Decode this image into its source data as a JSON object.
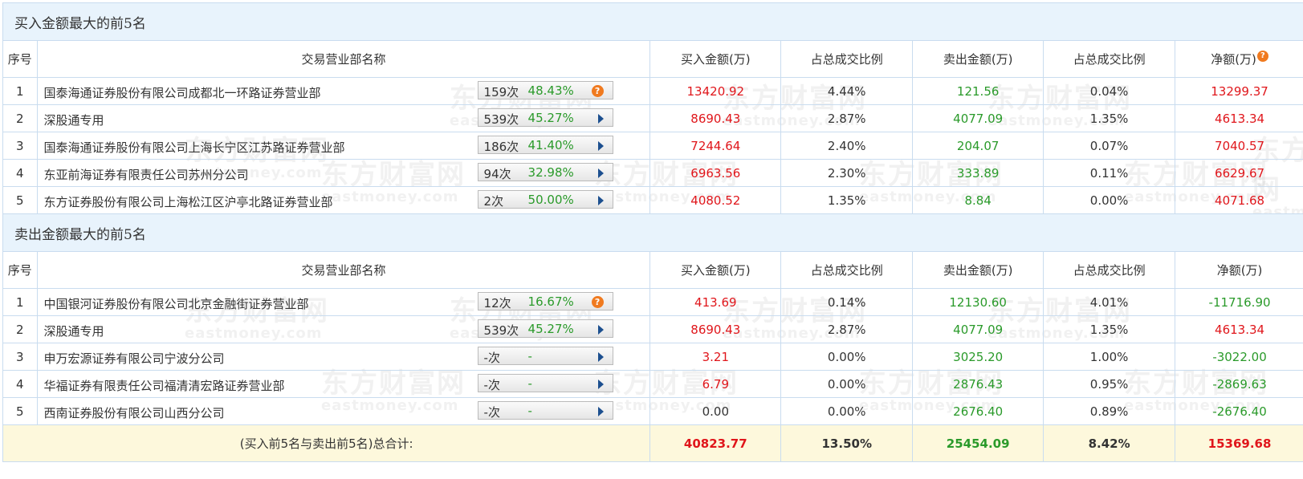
{
  "watermark": {
    "cn": "东方财富网",
    "en": "eastmoney.com"
  },
  "buy_section": {
    "title": "买入金额最大的前5名",
    "headers": [
      "序号",
      "交易营业部名称",
      "买入金额(万)",
      "占总成交比例",
      "卖出金额(万)",
      "占总成交比例",
      "净额(万)"
    ],
    "rows": [
      {
        "idx": "1",
        "name": "国泰海通证券股份有限公司成都北一环路证券营业部",
        "count": "159次",
        "pct": "48.43%",
        "icon": "question-icon",
        "buy": "13420.92",
        "buy_ratio": "4.44%",
        "sell": "121.56",
        "sell_ratio": "0.04%",
        "net": "13299.37"
      },
      {
        "idx": "2",
        "name": "深股通专用",
        "count": "539次",
        "pct": "45.27%",
        "icon": "arrow-right-icon",
        "buy": "8690.43",
        "buy_ratio": "2.87%",
        "sell": "4077.09",
        "sell_ratio": "1.35%",
        "net": "4613.34"
      },
      {
        "idx": "3",
        "name": "国泰海通证券股份有限公司上海长宁区江苏路证券营业部",
        "count": "186次",
        "pct": "41.40%",
        "icon": "arrow-right-icon",
        "buy": "7244.64",
        "buy_ratio": "2.40%",
        "sell": "204.07",
        "sell_ratio": "0.07%",
        "net": "7040.57"
      },
      {
        "idx": "4",
        "name": "东亚前海证券有限责任公司苏州分公司",
        "count": "94次",
        "pct": "32.98%",
        "icon": "arrow-right-icon",
        "buy": "6963.56",
        "buy_ratio": "2.30%",
        "sell": "333.89",
        "sell_ratio": "0.11%",
        "net": "6629.67"
      },
      {
        "idx": "5",
        "name": "东方证券股份有限公司上海松江区沪亭北路证券营业部",
        "count": "2次",
        "pct": "50.00%",
        "icon": "arrow-right-icon",
        "buy": "4080.52",
        "buy_ratio": "1.35%",
        "sell": "8.84",
        "sell_ratio": "0.00%",
        "net": "4071.68"
      }
    ]
  },
  "sell_section": {
    "title": "卖出金额最大的前5名",
    "headers": [
      "序号",
      "交易营业部名称",
      "买入金额(万)",
      "占总成交比例",
      "卖出金额(万)",
      "占总成交比例",
      "净额(万)"
    ],
    "rows": [
      {
        "idx": "1",
        "name": "中国银河证券股份有限公司北京金融街证券营业部",
        "count": "12次",
        "pct": "16.67%",
        "icon": "question-icon",
        "buy": "413.69",
        "buy_ratio": "0.14%",
        "sell": "12130.60",
        "sell_ratio": "4.01%",
        "net": "-11716.90"
      },
      {
        "idx": "2",
        "name": "深股通专用",
        "count": "539次",
        "pct": "45.27%",
        "icon": "arrow-right-icon",
        "buy": "8690.43",
        "buy_ratio": "2.87%",
        "sell": "4077.09",
        "sell_ratio": "1.35%",
        "net": "4613.34"
      },
      {
        "idx": "3",
        "name": "申万宏源证券有限公司宁波分公司",
        "count": "-次",
        "pct": "-",
        "icon": "arrow-right-icon",
        "buy": "3.21",
        "buy_ratio": "0.00%",
        "sell": "3025.20",
        "sell_ratio": "1.00%",
        "net": "-3022.00"
      },
      {
        "idx": "4",
        "name": "华福证券有限责任公司福清清宏路证券营业部",
        "count": "-次",
        "pct": "-",
        "icon": "arrow-right-icon",
        "buy": "6.79",
        "buy_ratio": "0.00%",
        "sell": "2876.43",
        "sell_ratio": "0.95%",
        "net": "-2869.63"
      },
      {
        "idx": "5",
        "name": "西南证券股份有限公司山西分公司",
        "count": "-次",
        "pct": "-",
        "icon": "arrow-right-icon",
        "buy": "0.00",
        "buy_ratio": "0.00%",
        "sell": "2676.40",
        "sell_ratio": "0.89%",
        "net": "-2676.40"
      }
    ]
  },
  "total": {
    "label": "(买入前5名与卖出前5名)总合计:",
    "buy": "40823.77",
    "buy_ratio": "13.50%",
    "sell": "25454.09",
    "sell_ratio": "8.42%",
    "net": "15369.68"
  },
  "colors": {
    "red": "#e0161b",
    "green": "#2a9a2a",
    "header_bg": "#e8f3fc",
    "total_bg": "#fdf8dc",
    "border": "#c9dcef"
  }
}
